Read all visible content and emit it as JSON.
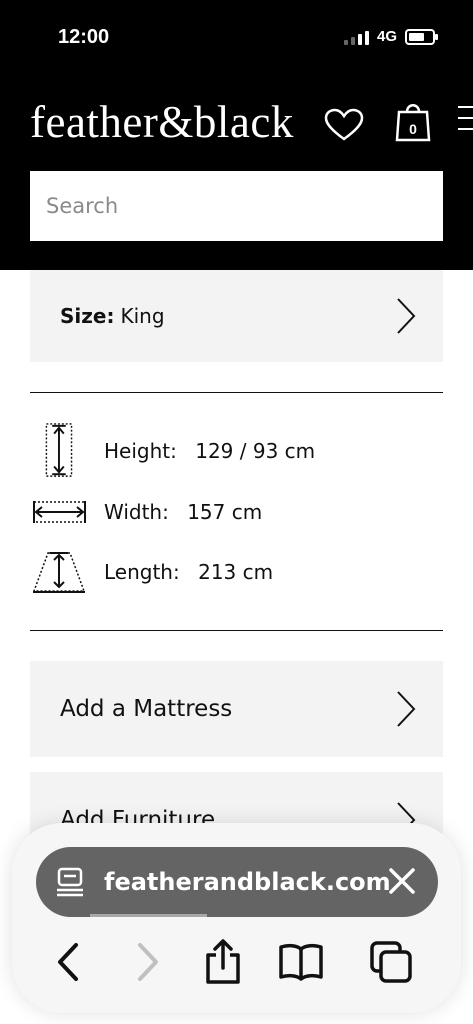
{
  "status_bar": {
    "time": "12:00",
    "network": "4G"
  },
  "header": {
    "logo": "feather&black",
    "cart_count": "0",
    "search_placeholder": "Search"
  },
  "size_selector": {
    "label": "Size:",
    "value": "King"
  },
  "dimensions": [
    {
      "label": "Height:",
      "value": "129 / 93 cm",
      "icon": "height-icon"
    },
    {
      "label": "Width:",
      "value": "157 cm",
      "icon": "width-icon"
    },
    {
      "label": "Length:",
      "value": "213 cm",
      "icon": "length-icon"
    }
  ],
  "add_ons": [
    {
      "label": "Add a Mattress"
    },
    {
      "label": "Add Furniture"
    }
  ],
  "browser": {
    "url": "featherandblack.com",
    "page_load_progress": 0.29
  }
}
